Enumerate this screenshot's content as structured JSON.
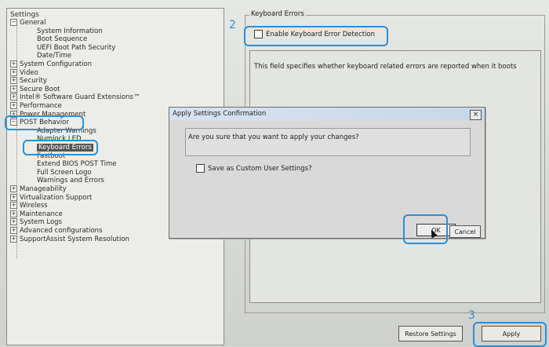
{
  "tree": {
    "title": "Settings",
    "items": [
      {
        "label": "General",
        "level": 0,
        "toggle": "−"
      },
      {
        "label": "System Information",
        "level": 2,
        "toggle": ""
      },
      {
        "label": "Boot Sequence",
        "level": 2,
        "toggle": ""
      },
      {
        "label": "UEFI Boot Path Security",
        "level": 2,
        "toggle": ""
      },
      {
        "label": "Date/Time",
        "level": 2,
        "toggle": ""
      },
      {
        "label": "System Configuration",
        "level": 0,
        "toggle": "+"
      },
      {
        "label": "Video",
        "level": 0,
        "toggle": "+"
      },
      {
        "label": "Security",
        "level": 0,
        "toggle": "+"
      },
      {
        "label": "Secure Boot",
        "level": 0,
        "toggle": "+"
      },
      {
        "label": "Intel® Software Guard Extensions™",
        "level": 0,
        "toggle": "+"
      },
      {
        "label": "Performance",
        "level": 0,
        "toggle": "+"
      },
      {
        "label": "Power Management",
        "level": 0,
        "toggle": "+"
      },
      {
        "label": "POST Behavior",
        "level": 0,
        "toggle": "−"
      },
      {
        "label": "Adapter Warnings",
        "level": 2,
        "toggle": ""
      },
      {
        "label": "Numlock LED",
        "level": 2,
        "toggle": ""
      },
      {
        "label": "Keyboard Errors",
        "level": 2,
        "toggle": "",
        "selected": true
      },
      {
        "label": "Fastboot",
        "level": 2,
        "toggle": ""
      },
      {
        "label": "Extend BIOS POST Time",
        "level": 2,
        "toggle": ""
      },
      {
        "label": "Full Screen Logo",
        "level": 2,
        "toggle": ""
      },
      {
        "label": "Warnings and Errors",
        "level": 2,
        "toggle": ""
      },
      {
        "label": "Manageability",
        "level": 0,
        "toggle": "+"
      },
      {
        "label": "Virtualization Support",
        "level": 0,
        "toggle": "+"
      },
      {
        "label": "Wireless",
        "level": 0,
        "toggle": "+"
      },
      {
        "label": "Maintenance",
        "level": 0,
        "toggle": "+"
      },
      {
        "label": "System Logs",
        "level": 0,
        "toggle": "+"
      },
      {
        "label": "Advanced configurations",
        "level": 0,
        "toggle": "+"
      },
      {
        "label": "SupportAssist System Resolution",
        "level": 0,
        "toggle": "+"
      }
    ]
  },
  "panel": {
    "group_title": "Keyboard Errors",
    "checkbox_label": "Enable Keyboard Error Detection",
    "description": "This field specifies whether keyboard related errors are reported when it boots"
  },
  "footer": {
    "restore_label": "Restore Settings",
    "apply_label": "Apply"
  },
  "dialog": {
    "title": "Apply Settings Confirmation",
    "close_label": "×",
    "message": "Are you sure that you want to apply your changes?",
    "checkbox_label": "Save as Custom User Settings?",
    "ok_label": "OK",
    "cancel_label": "Cancel"
  },
  "annotations": {
    "step2": "2",
    "step3": "3",
    "color": "#2a8fd8"
  }
}
